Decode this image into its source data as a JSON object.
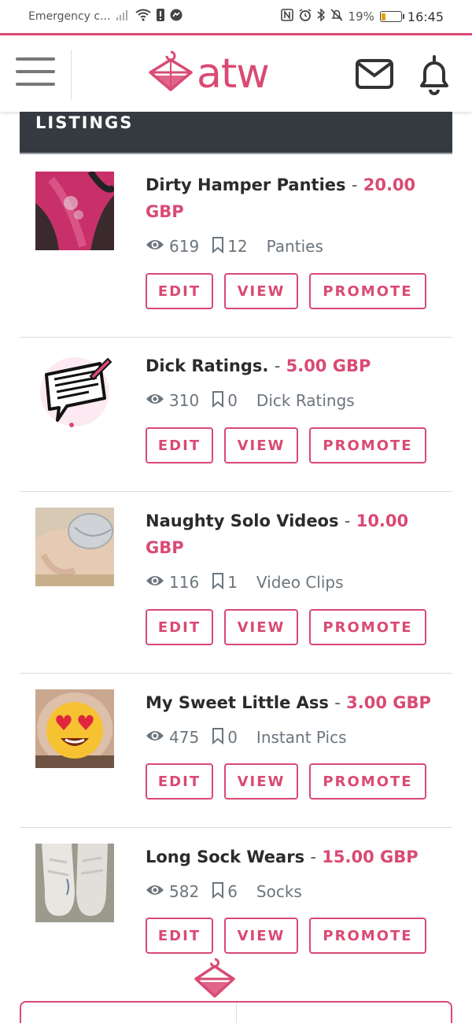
{
  "status_bar": {
    "carrier": "Emergency c...",
    "battery_percent": "19%",
    "battery_level": 0.19,
    "time": "16:45"
  },
  "header": {
    "logo_text": "atw",
    "accent_color": "#d94a74"
  },
  "section": {
    "title": "LISTINGS"
  },
  "buttons": {
    "edit": "EDIT",
    "view": "VIEW",
    "promote": "PROMOTE"
  },
  "listings": [
    {
      "title": "Dirty Hamper Panties",
      "separator": "-",
      "price": "20.00",
      "currency": "GBP",
      "views": "619",
      "bookmarks": "12",
      "category": "Panties",
      "thumb": "panties-photo"
    },
    {
      "title": "Dick Ratings.",
      "separator": "-",
      "price": "5.00 GBP",
      "views": "310",
      "bookmarks": "0",
      "category": "Dick Ratings",
      "thumb": "speech-bubble-icon"
    },
    {
      "title": "Naughty Solo Videos",
      "separator": "-",
      "price": "10.00",
      "currency": "GBP",
      "views": "116",
      "bookmarks": "1",
      "category": "Video Clips",
      "thumb": "solo-photo"
    },
    {
      "title": "My Sweet Little Ass",
      "separator": "-",
      "price": "3.00 GBP",
      "views": "475",
      "bookmarks": "0",
      "category": "Instant Pics",
      "thumb": "emoji-photo"
    },
    {
      "title": "Long Sock Wears",
      "separator": "-",
      "price": "15.00 GBP",
      "views": "582",
      "bookmarks": "6",
      "category": "Socks",
      "thumb": "socks-photo"
    }
  ]
}
